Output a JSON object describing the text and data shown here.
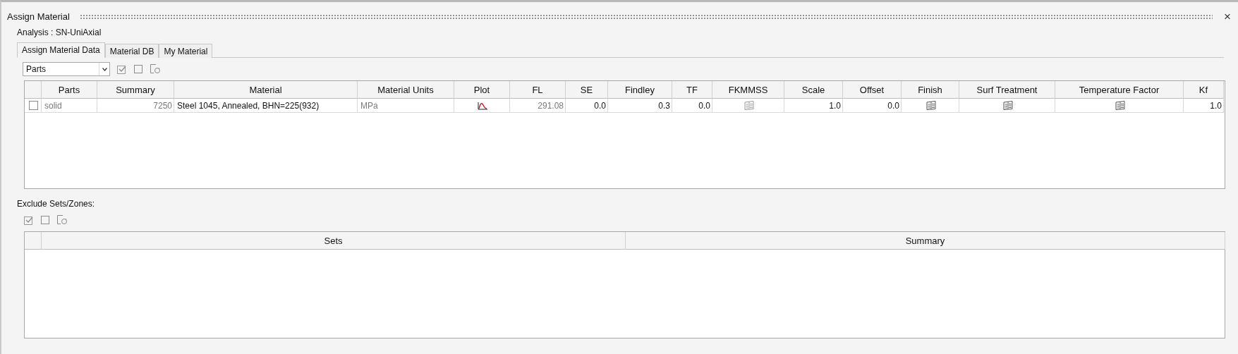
{
  "panel": {
    "title": "Assign Material",
    "close": "×"
  },
  "analysis": "Analysis : SN-UniAxial",
  "tabs": [
    {
      "label": "Assign Material Data",
      "selected": true
    },
    {
      "label": "Material DB",
      "selected": false
    },
    {
      "label": "My Material",
      "selected": false
    }
  ],
  "filter": {
    "value": "Parts"
  },
  "table": {
    "columns": [
      "",
      "Parts",
      "Summary",
      "Material",
      "Material Units",
      "Plot",
      "FL",
      "SE",
      "Findley",
      "TF",
      "FKMMSS",
      "Scale",
      "Offset",
      "Finish",
      "Surf Treatment",
      "Temperature Factor",
      "Kf"
    ],
    "rows": [
      {
        "cells": [
          {
            "kind": "checkbox",
            "checked": false
          },
          {
            "kind": "text",
            "text": "solid",
            "greyed": true
          },
          {
            "kind": "text",
            "text": "7250",
            "greyed": true
          },
          {
            "kind": "text",
            "text": "Steel 1045, Annealed, BHN=225(932)",
            "greyed": false
          },
          {
            "kind": "text",
            "text": "MPa",
            "greyed": true
          },
          {
            "kind": "plot"
          },
          {
            "kind": "text",
            "text": "291.08",
            "greyed": true
          },
          {
            "kind": "text",
            "text": "0.0",
            "greyed": false
          },
          {
            "kind": "text",
            "text": "0.3",
            "greyed": false
          },
          {
            "kind": "text",
            "text": "0.0",
            "greyed": false
          },
          {
            "kind": "grid",
            "greyed": true
          },
          {
            "kind": "text",
            "text": "1.0",
            "greyed": false
          },
          {
            "kind": "text",
            "text": "0.0",
            "greyed": false
          },
          {
            "kind": "grid",
            "greyed": false
          },
          {
            "kind": "grid",
            "greyed": false
          },
          {
            "kind": "grid",
            "greyed": false
          },
          {
            "kind": "text",
            "text": "1.0",
            "greyed": false
          }
        ]
      }
    ]
  },
  "exclude": {
    "label": "Exclude Sets/Zones:",
    "columns": [
      "",
      "Sets",
      "Summary"
    ]
  }
}
